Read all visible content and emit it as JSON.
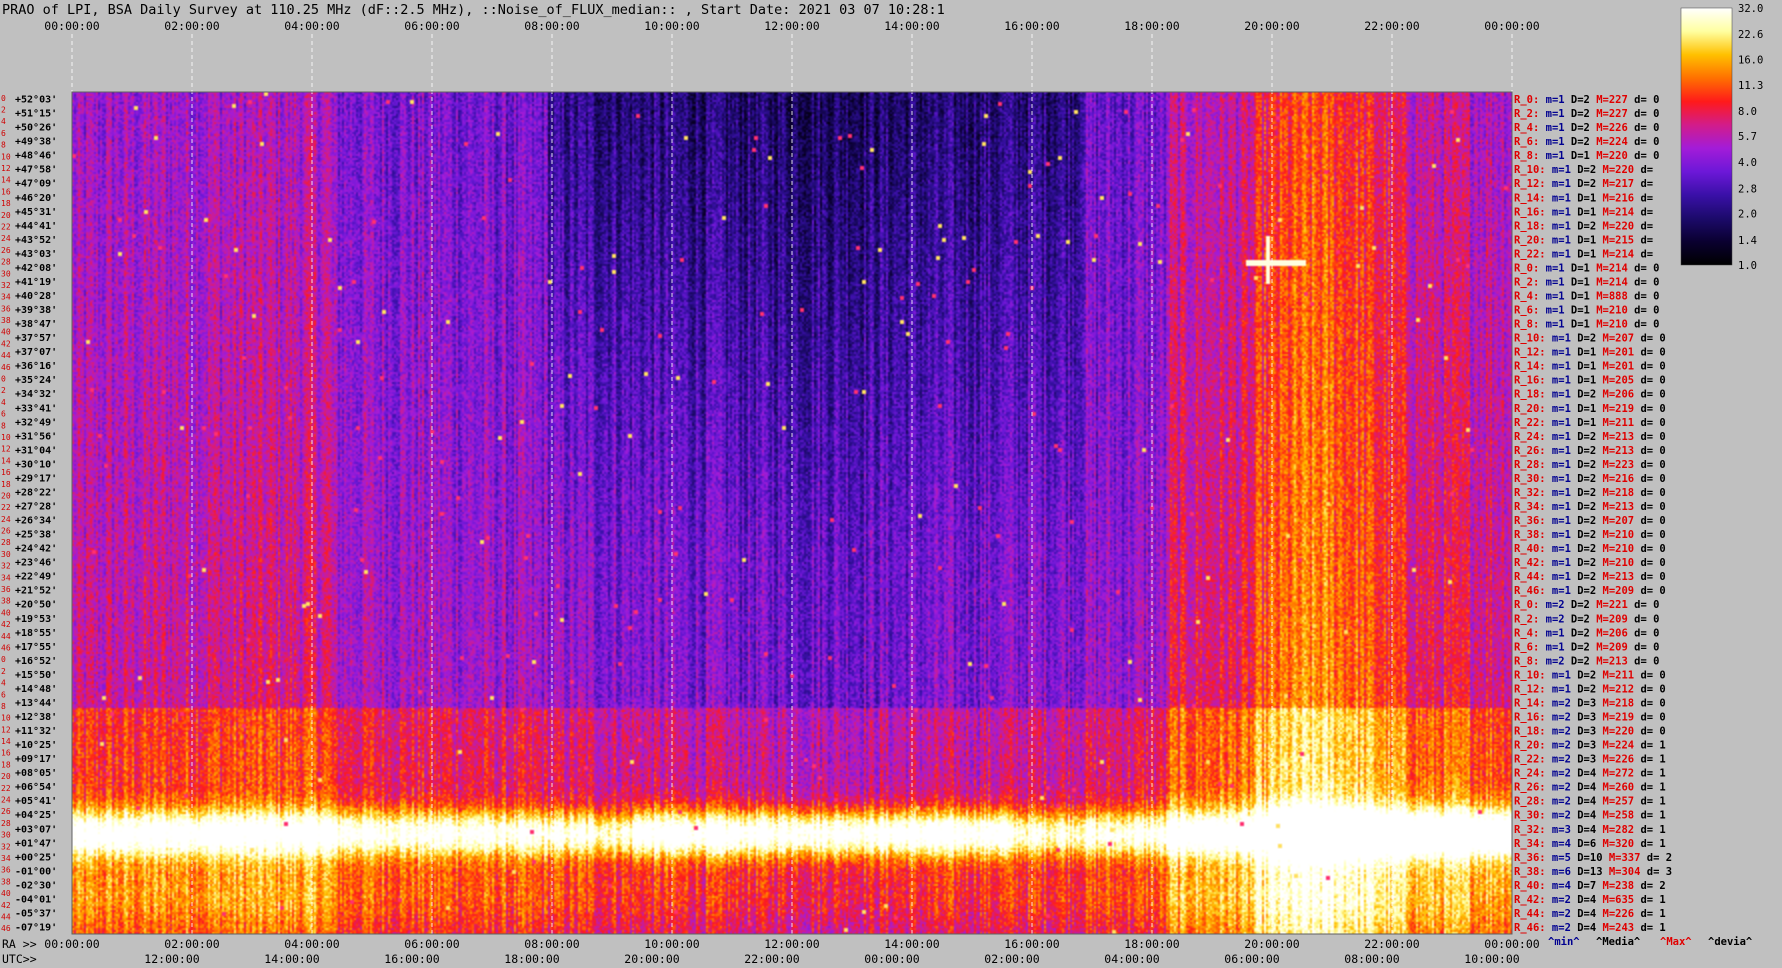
{
  "chart_data": {
    "type": "heatmap",
    "title": "PRAO of LPI, BSA Daily Survey at 110.25 MHz (dF::2.5 MHz), ::Noise_of_FLUX_median:: , Start Date: 2021 03 07 10:28:1",
    "top_ticks": [
      "00:00:00",
      "02:00:00",
      "04:00:00",
      "06:00:00",
      "08:00:00",
      "10:00:00",
      "12:00:00",
      "14:00:00",
      "16:00:00",
      "18:00:00",
      "20:00:00",
      "22:00:00",
      "00:00:00"
    ],
    "ra_label": "RA >>",
    "ra_ticks": [
      "00:00:00",
      "02:00:00",
      "04:00:00",
      "06:00:00",
      "08:00:00",
      "10:00:00",
      "12:00:00",
      "14:00:00",
      "16:00:00",
      "18:00:00",
      "20:00:00",
      "22:00:00",
      "00:00:00"
    ],
    "utc_label": "UTC>>",
    "utc_ticks": [
      "12:00:00",
      "14:00:00",
      "16:00:00",
      "18:00:00",
      "20:00:00",
      "22:00:00",
      "00:00:00",
      "02:00:00",
      "04:00:00",
      "06:00:00",
      "08:00:00",
      "10:00:00"
    ],
    "declinations": [
      "+52°03'",
      "+51°15'",
      "+50°26'",
      "+49°38'",
      "+48°46'",
      "+47°58'",
      "+47°09'",
      "+46°20'",
      "+45°31'",
      "+44°41'",
      "+43°52'",
      "+43°03'",
      "+42°08'",
      "+41°19'",
      "+40°28'",
      "+39°38'",
      "+38°47'",
      "+37°57'",
      "+37°07'",
      "+36°16'",
      "+35°24'",
      "+34°32'",
      "+33°41'",
      "+32°49'",
      "+31°56'",
      "+31°04'",
      "+30°10'",
      "+29°17'",
      "+28°22'",
      "+27°28'",
      "+26°34'",
      "+25°38'",
      "+24°42'",
      "+23°46'",
      "+22°49'",
      "+21°52'",
      "+20°50'",
      "+19°53'",
      "+18°55'",
      "+17°55'",
      "+16°52'",
      "+15°50'",
      "+14°48'",
      "+13°44'",
      "+12°38'",
      "+11°32'",
      "+10°25'",
      "+09°17'",
      "+08°05'",
      "+06°54'",
      "+05°41'",
      "+04°25'",
      "+03°07'",
      "+01°47'",
      "+00°25'",
      "-01°00'",
      "-02°30'",
      "-04°01'",
      "-05°37'",
      "-07°19'"
    ],
    "row_index": [
      "0",
      "2",
      "4",
      "6",
      "8",
      "10",
      "12",
      "14",
      "16",
      "18",
      "20",
      "22",
      "24",
      "26",
      "28",
      "30",
      "32",
      "34",
      "36",
      "38",
      "40",
      "42",
      "44",
      "46",
      "0",
      "2",
      "4",
      "6",
      "8",
      "10",
      "12",
      "14",
      "16",
      "18",
      "20",
      "22",
      "24",
      "26",
      "28",
      "30",
      "32",
      "34",
      "36",
      "38",
      "40",
      "42",
      "44",
      "46",
      "0",
      "2",
      "4",
      "6",
      "8",
      "10",
      "12",
      "14",
      "16",
      "18",
      "20",
      "22",
      "24",
      "26",
      "28",
      "30",
      "32",
      "34",
      "36",
      "38",
      "40",
      "42",
      "44",
      "46"
    ],
    "right_rows": [
      {
        "r": "R_0:",
        "m": "m=1",
        "D": "D=2",
        "M": "M=227",
        "d": "d= 0"
      },
      {
        "r": "R_2:",
        "m": "m=1",
        "D": "D=2",
        "M": "M=227",
        "d": "d= 0"
      },
      {
        "r": "R_4:",
        "m": "m=1",
        "D": "D=2",
        "M": "M=226",
        "d": "d= 0"
      },
      {
        "r": "R_6:",
        "m": "m=1",
        "D": "D=2",
        "M": "M=224",
        "d": "d= 0"
      },
      {
        "r": "R_8:",
        "m": "m=1",
        "D": "D=1",
        "M": "M=220",
        "d": "d= 0"
      },
      {
        "r": "R_10:",
        "m": "m=1",
        "D": "D=2",
        "M": "M=220",
        "d": "d="
      },
      {
        "r": "R_12:",
        "m": "m=1",
        "D": "D=2",
        "M": "M=217",
        "d": "d="
      },
      {
        "r": "R_14:",
        "m": "m=1",
        "D": "D=1",
        "M": "M=216",
        "d": "d="
      },
      {
        "r": "R_16:",
        "m": "m=1",
        "D": "D=1",
        "M": "M=214",
        "d": "d="
      },
      {
        "r": "R_18:",
        "m": "m=1",
        "D": "D=2",
        "M": "M=220",
        "d": "d="
      },
      {
        "r": "R_20:",
        "m": "m=1",
        "D": "D=1",
        "M": "M=215",
        "d": "d="
      },
      {
        "r": "R_22:",
        "m": "m=1",
        "D": "D=1",
        "M": "M=214",
        "d": "d="
      },
      {
        "r": "R_0:",
        "m": "m=1",
        "D": "D=1",
        "M": "M=214",
        "d": "d= 0"
      },
      {
        "r": "R_2:",
        "m": "m=1",
        "D": "D=1",
        "M": "M=214",
        "d": "d= 0"
      },
      {
        "r": "R_4:",
        "m": "m=1",
        "D": "D=1",
        "M": "M=888",
        "d": "d= 0"
      },
      {
        "r": "R_6:",
        "m": "m=1",
        "D": "D=1",
        "M": "M=210",
        "d": "d= 0"
      },
      {
        "r": "R_8:",
        "m": "m=1",
        "D": "D=1",
        "M": "M=210",
        "d": "d= 0"
      },
      {
        "r": "R_10:",
        "m": "m=1",
        "D": "D=2",
        "M": "M=207",
        "d": "d= 0"
      },
      {
        "r": "R_12:",
        "m": "m=1",
        "D": "D=1",
        "M": "M=201",
        "d": "d= 0"
      },
      {
        "r": "R_14:",
        "m": "m=1",
        "D": "D=1",
        "M": "M=201",
        "d": "d= 0"
      },
      {
        "r": "R_16:",
        "m": "m=1",
        "D": "D=1",
        "M": "M=205",
        "d": "d= 0"
      },
      {
        "r": "R_18:",
        "m": "m=1",
        "D": "D=2",
        "M": "M=206",
        "d": "d= 0"
      },
      {
        "r": "R_20:",
        "m": "m=1",
        "D": "D=1",
        "M": "M=219",
        "d": "d= 0"
      },
      {
        "r": "R_22:",
        "m": "m=1",
        "D": "D=1",
        "M": "M=211",
        "d": "d= 0"
      },
      {
        "r": "R_24:",
        "m": "m=1",
        "D": "D=2",
        "M": "M=213",
        "d": "d= 0"
      },
      {
        "r": "R_26:",
        "m": "m=1",
        "D": "D=2",
        "M": "M=213",
        "d": "d= 0"
      },
      {
        "r": "R_28:",
        "m": "m=1",
        "D": "D=2",
        "M": "M=223",
        "d": "d= 0"
      },
      {
        "r": "R_30:",
        "m": "m=1",
        "D": "D=2",
        "M": "M=216",
        "d": "d= 0"
      },
      {
        "r": "R_32:",
        "m": "m=1",
        "D": "D=2",
        "M": "M=218",
        "d": "d= 0"
      },
      {
        "r": "R_34:",
        "m": "m=1",
        "D": "D=2",
        "M": "M=213",
        "d": "d= 0"
      },
      {
        "r": "R_36:",
        "m": "m=1",
        "D": "D=2",
        "M": "M=207",
        "d": "d= 0"
      },
      {
        "r": "R_38:",
        "m": "m=1",
        "D": "D=2",
        "M": "M=210",
        "d": "d= 0"
      },
      {
        "r": "R_40:",
        "m": "m=1",
        "D": "D=2",
        "M": "M=210",
        "d": "d= 0"
      },
      {
        "r": "R_42:",
        "m": "m=1",
        "D": "D=2",
        "M": "M=210",
        "d": "d= 0"
      },
      {
        "r": "R_44:",
        "m": "m=1",
        "D": "D=2",
        "M": "M=213",
        "d": "d= 0"
      },
      {
        "r": "R_46:",
        "m": "m=1",
        "D": "D=2",
        "M": "M=209",
        "d": "d= 0"
      },
      {
        "r": "R_0:",
        "m": "m=2",
        "D": "D=2",
        "M": "M=221",
        "d": "d= 0"
      },
      {
        "r": "R_2:",
        "m": "m=2",
        "D": "D=2",
        "M": "M=209",
        "d": "d= 0"
      },
      {
        "r": "R_4:",
        "m": "m=1",
        "D": "D=2",
        "M": "M=206",
        "d": "d= 0"
      },
      {
        "r": "R_6:",
        "m": "m=1",
        "D": "D=2",
        "M": "M=209",
        "d": "d= 0"
      },
      {
        "r": "R_8:",
        "m": "m=2",
        "D": "D=2",
        "M": "M=213",
        "d": "d= 0"
      },
      {
        "r": "R_10:",
        "m": "m=1",
        "D": "D=2",
        "M": "M=211",
        "d": "d= 0"
      },
      {
        "r": "R_12:",
        "m": "m=1",
        "D": "D=2",
        "M": "M=212",
        "d": "d= 0"
      },
      {
        "r": "R_14:",
        "m": "m=2",
        "D": "D=3",
        "M": "M=218",
        "d": "d= 0"
      },
      {
        "r": "R_16:",
        "m": "m=2",
        "D": "D=3",
        "M": "M=219",
        "d": "d= 0"
      },
      {
        "r": "R_18:",
        "m": "m=2",
        "D": "D=3",
        "M": "M=220",
        "d": "d= 0"
      },
      {
        "r": "R_20:",
        "m": "m=2",
        "D": "D=3",
        "M": "M=224",
        "d": "d= 1"
      },
      {
        "r": "R_22:",
        "m": "m=2",
        "D": "D=3",
        "M": "M=226",
        "d": "d= 1"
      },
      {
        "r": "R_24:",
        "m": "m=2",
        "D": "D=4",
        "M": "M=272",
        "d": "d= 1"
      },
      {
        "r": "R_26:",
        "m": "m=2",
        "D": "D=4",
        "M": "M=260",
        "d": "d= 1"
      },
      {
        "r": "R_28:",
        "m": "m=2",
        "D": "D=4",
        "M": "M=257",
        "d": "d= 1"
      },
      {
        "r": "R_30:",
        "m": "m=2",
        "D": "D=4",
        "M": "M=258",
        "d": "d= 1"
      },
      {
        "r": "R_32:",
        "m": "m=3",
        "D": "D=4",
        "M": "M=282",
        "d": "d= 1"
      },
      {
        "r": "R_34:",
        "m": "m=4",
        "D": "D=6",
        "M": "M=320",
        "d": "d= 1"
      },
      {
        "r": "R_36:",
        "m": "m=5",
        "D": "D=10",
        "M": "M=337",
        "d": "d= 2"
      },
      {
        "r": "R_38:",
        "m": "m=6",
        "D": "D=13",
        "M": "M=304",
        "d": "d= 3"
      },
      {
        "r": "R_40:",
        "m": "m=4",
        "D": "D=7",
        "M": "M=238",
        "d": "d= 2"
      },
      {
        "r": "R_42:",
        "m": "m=2",
        "D": "D=4",
        "M": "M=635",
        "d": "d= 1"
      },
      {
        "r": "R_44:",
        "m": "m=2",
        "D": "D=4",
        "M": "M=226",
        "d": "d= 1"
      },
      {
        "r": "R_46:",
        "m": "m=2",
        "D": "D=4",
        "M": "M=243",
        "d": "d= 1"
      }
    ],
    "footer_labels": [
      "^min^",
      "^Media^",
      "^Max^",
      "^devia^"
    ],
    "colorbar": {
      "ticks": [
        "32.0",
        "22.6",
        "16.0",
        "11.3",
        "8.0",
        "5.7",
        "4.0",
        "2.8",
        "2.0",
        "1.4",
        "1.0"
      ],
      "range": [
        1.0,
        32.0
      ],
      "scale": "log"
    },
    "colors": {
      "background": "#c0c0c0",
      "row_label_red": "#e00000",
      "row_label_blue": "#000090",
      "palette": [
        "#000000",
        "#0a0030",
        "#1c0a6b",
        "#3a10a8",
        "#6d18d8",
        "#a31cd8",
        "#d21c8a",
        "#ff1a1a",
        "#ff7000",
        "#ffc000",
        "#ffffa0",
        "#ffffff"
      ]
    }
  }
}
